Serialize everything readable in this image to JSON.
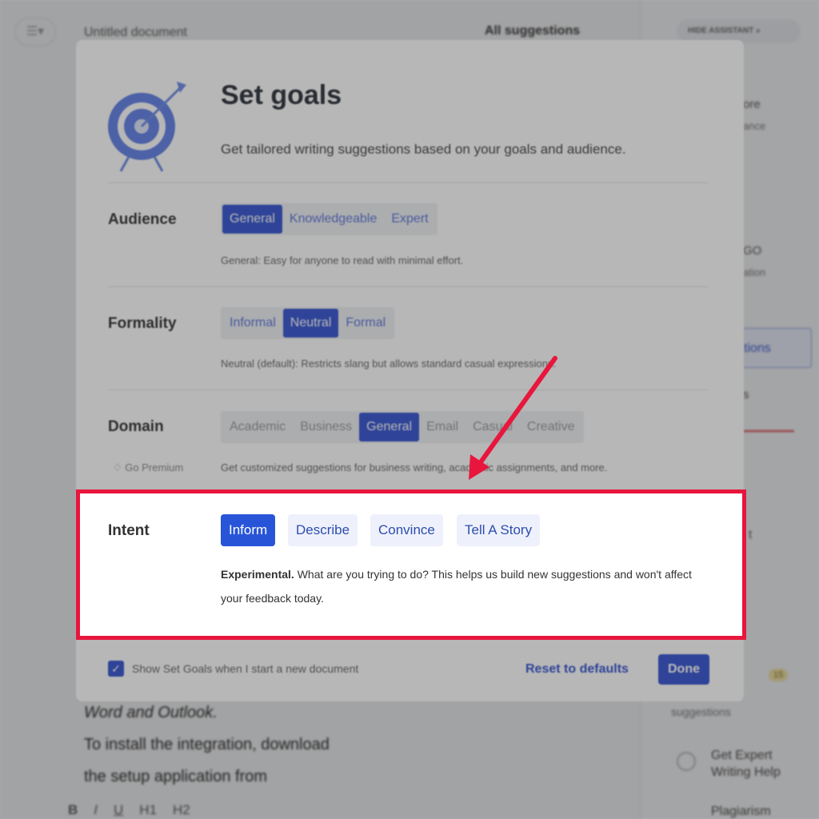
{
  "background": {
    "doc_title": "Untitled document",
    "all_suggestions": "All suggestions",
    "hide_assistant": "HIDE ASSISTANT",
    "doc_lines": [
      "Word and Outlook.",
      "To install the integration, download",
      "the setup application from"
    ],
    "sidebar": {
      "item1a": "ore",
      "item1b": "ance",
      "go": "GO",
      "go_sub": "ation",
      "suggestions_btn": "tions",
      "s_label": "s",
      "t_label": "t",
      "badge": "15",
      "suggestions_text": "suggestions",
      "expert": "Get Expert",
      "expert2": "Writing Help",
      "plagiarism": "Plagiarism"
    },
    "toolbar": [
      "B",
      "I",
      "U",
      "H1",
      "H2"
    ]
  },
  "modal": {
    "title": "Set goals",
    "subtitle": "Get tailored writing suggestions based on your goals and audience.",
    "audience": {
      "label": "Audience",
      "options": [
        "General",
        "Knowledgeable",
        "Expert"
      ],
      "selected": 0,
      "hint_bold": "General:",
      "hint": " Easy for anyone to read with minimal effort."
    },
    "formality": {
      "label": "Formality",
      "options": [
        "Informal",
        "Neutral",
        "Formal"
      ],
      "selected": 1,
      "hint": "Neutral (default): Restricts slang but allows standard casual expressions."
    },
    "domain": {
      "label": "Domain",
      "options": [
        "Academic",
        "Business",
        "General",
        "Email",
        "Casual",
        "Creative"
      ],
      "selected": 2,
      "premium": "Go Premium",
      "hint": "Get customized suggestions for business writing, academic assignments, and more."
    },
    "intent": {
      "label": "Intent",
      "options": [
        "Inform",
        "Describe",
        "Convince",
        "Tell A Story"
      ],
      "selected": 0,
      "hint_bold": "Experimental.",
      "hint": " What are you trying to do? This helps us build new suggestions and won't affect your feedback today."
    },
    "footer": {
      "checkbox_label": "Show Set Goals when I start a new document",
      "checked": true,
      "reset": "Reset to defaults",
      "done": "Done"
    }
  },
  "colors": {
    "accent": "#3453d1",
    "highlight": "#e8163d"
  }
}
